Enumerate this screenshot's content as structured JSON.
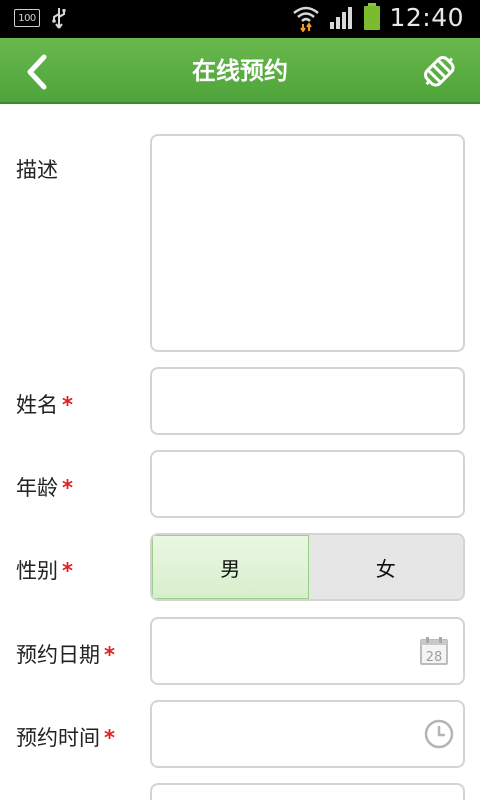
{
  "status_bar": {
    "battery_percent": "100",
    "time": "12:40"
  },
  "header": {
    "title": "在线预约"
  },
  "form": {
    "description": {
      "label": "描述",
      "value": ""
    },
    "name": {
      "label": "姓名",
      "required_mark": "*",
      "value": ""
    },
    "age": {
      "label": "年龄",
      "required_mark": "*",
      "value": ""
    },
    "gender": {
      "label": "性别",
      "required_mark": "*",
      "options": [
        "男",
        "女"
      ],
      "selected": "男"
    },
    "date": {
      "label": "预约日期",
      "required_mark": "*",
      "value": "",
      "calendar_day": "28"
    },
    "time": {
      "label": "预约时间",
      "required_mark": "*",
      "value": ""
    }
  },
  "colors": {
    "header_green": "#5aad43",
    "required_red": "#e02020",
    "selected_bg": "#dff2d6"
  }
}
